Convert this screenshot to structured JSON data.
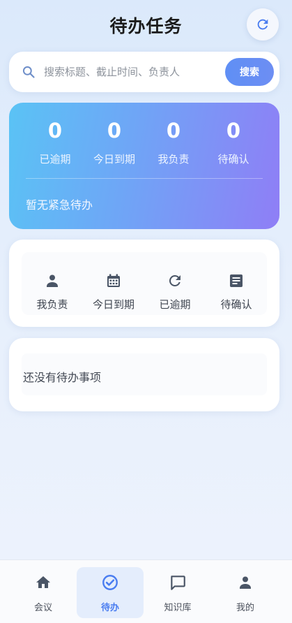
{
  "header": {
    "title": "待办任务"
  },
  "search": {
    "placeholder": "搜索标题、截止时间、负责人",
    "button_label": "搜索"
  },
  "stats": {
    "items": [
      {
        "value": "0",
        "label": "已逾期"
      },
      {
        "value": "0",
        "label": "今日到期"
      },
      {
        "value": "0",
        "label": "我负责"
      },
      {
        "value": "0",
        "label": "待确认"
      }
    ],
    "urgent_text": "暂无紧急待办"
  },
  "quick_filters": {
    "items": [
      {
        "label": "我负责",
        "icon": "person-icon"
      },
      {
        "label": "今日到期",
        "icon": "calendar-icon"
      },
      {
        "label": "已逾期",
        "icon": "refresh-icon"
      },
      {
        "label": "待确认",
        "icon": "document-icon"
      }
    ]
  },
  "empty_state": {
    "text": "还没有待办事项"
  },
  "tabbar": {
    "items": [
      {
        "label": "会议",
        "icon": "home-icon",
        "active": false
      },
      {
        "label": "待办",
        "icon": "check-circle-icon",
        "active": true
      },
      {
        "label": "知识库",
        "icon": "chat-icon",
        "active": false
      },
      {
        "label": "我的",
        "icon": "person-icon",
        "active": false
      }
    ]
  },
  "colors": {
    "accent": "#5f8ff5",
    "active_tab_bg": "#e4edfc",
    "active_tab_text": "#4a7df0",
    "stats_gradient_start": "#5ac3f5",
    "stats_gradient_end": "#8f7ef6"
  }
}
